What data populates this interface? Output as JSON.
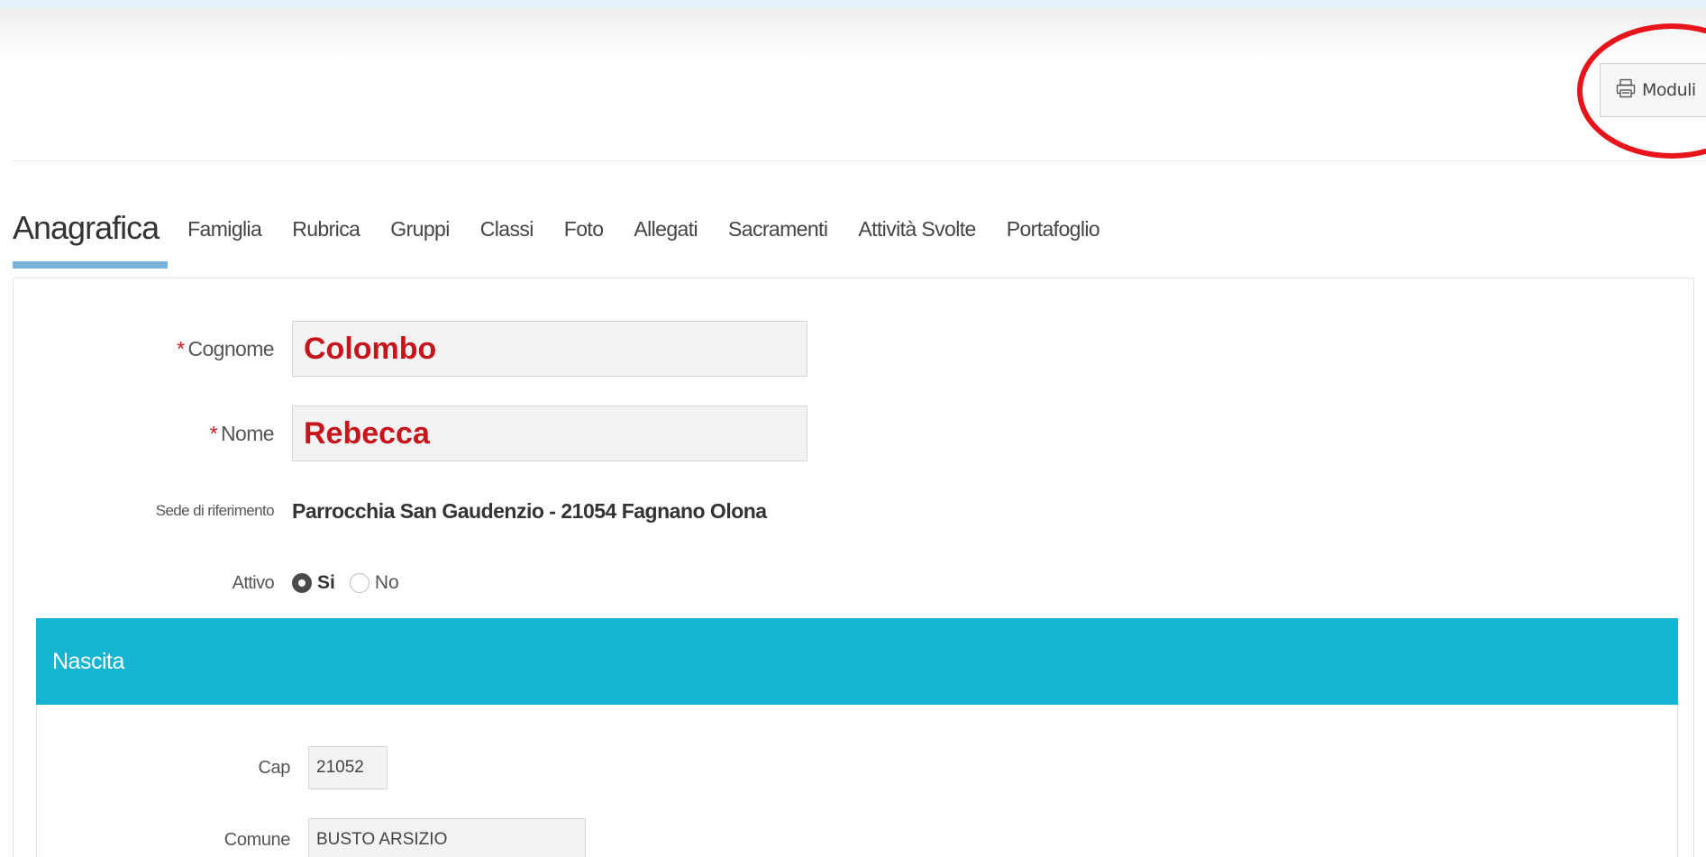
{
  "header": {
    "moduli_label": "Moduli",
    "moduli_icon": "printer-icon",
    "annotation_color": "#e8141b"
  },
  "tabs": [
    {
      "label": "Anagrafica",
      "active": true
    },
    {
      "label": "Famiglia"
    },
    {
      "label": "Rubrica"
    },
    {
      "label": "Gruppi"
    },
    {
      "label": "Classi"
    },
    {
      "label": "Foto"
    },
    {
      "label": "Allegati"
    },
    {
      "label": "Sacramenti"
    },
    {
      "label": "Attività Svolte"
    },
    {
      "label": "Portafoglio"
    }
  ],
  "form": {
    "required_marker": "*",
    "cognome": {
      "label": "Cognome",
      "value": "Colombo"
    },
    "nome": {
      "label": "Nome",
      "value": "Rebecca"
    },
    "sede": {
      "label": "Sede di riferimento",
      "value": "Parrocchia San Gaudenzio - 21054 Fagnano Olona"
    },
    "attivo": {
      "label": "Attivo",
      "option_si": "Si",
      "option_no": "No",
      "selected": "Si"
    }
  },
  "nascita": {
    "title": "Nascita",
    "cap": {
      "label": "Cap",
      "value": "21052"
    },
    "comune": {
      "label": "Comune",
      "value": "BUSTO ARSIZIO"
    }
  },
  "colors": {
    "section_header": "#15b4d0",
    "tab_underline": "#7ab3d9",
    "input_value": "#c8141b"
  }
}
